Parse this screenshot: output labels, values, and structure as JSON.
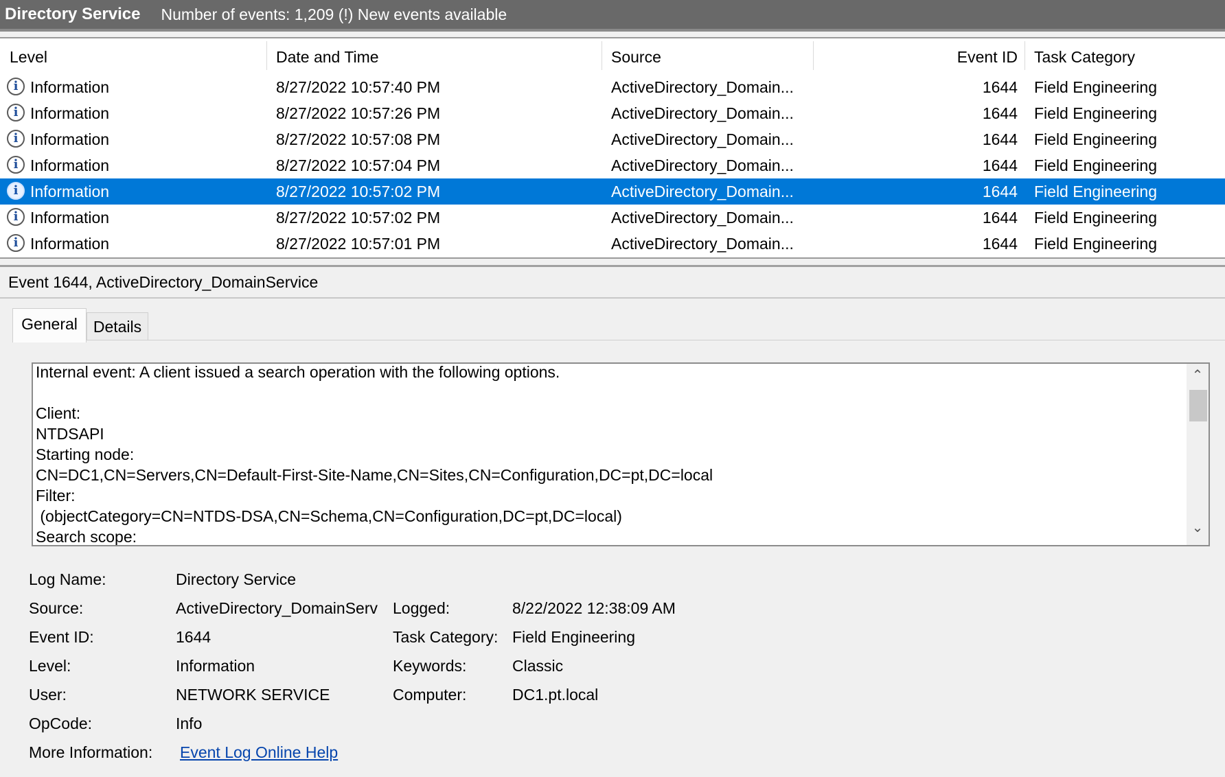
{
  "titlebar": {
    "app_name": "Directory Service",
    "event_count": "Number of events: 1,209 (!) New events available"
  },
  "grid": {
    "columns": [
      "Level",
      "Date and Time",
      "Source",
      "Event ID",
      "Task Category"
    ],
    "rows": [
      {
        "level": "Information",
        "datetime": "8/27/2022 10:57:40 PM",
        "source": "ActiveDirectory_Domain...",
        "event_id": "1644",
        "task": "Field Engineering",
        "selected": false
      },
      {
        "level": "Information",
        "datetime": "8/27/2022 10:57:26 PM",
        "source": "ActiveDirectory_Domain...",
        "event_id": "1644",
        "task": "Field Engineering",
        "selected": false
      },
      {
        "level": "Information",
        "datetime": "8/27/2022 10:57:08 PM",
        "source": "ActiveDirectory_Domain...",
        "event_id": "1644",
        "task": "Field Engineering",
        "selected": false
      },
      {
        "level": "Information",
        "datetime": "8/27/2022 10:57:04 PM",
        "source": "ActiveDirectory_Domain...",
        "event_id": "1644",
        "task": "Field Engineering",
        "selected": false
      },
      {
        "level": "Information",
        "datetime": "8/27/2022 10:57:02 PM",
        "source": "ActiveDirectory_Domain...",
        "event_id": "1644",
        "task": "Field Engineering",
        "selected": true
      },
      {
        "level": "Information",
        "datetime": "8/27/2022 10:57:02 PM",
        "source": "ActiveDirectory_Domain...",
        "event_id": "1644",
        "task": "Field Engineering",
        "selected": false
      },
      {
        "level": "Information",
        "datetime": "8/27/2022 10:57:01 PM",
        "source": "ActiveDirectory_Domain...",
        "event_id": "1644",
        "task": "Field Engineering",
        "selected": false
      }
    ],
    "level_icon": "information-icon",
    "selected_color": "#0078d7"
  },
  "event": {
    "header": "Event 1644, ActiveDirectory_DomainService",
    "tabs": [
      "General",
      "Details"
    ],
    "description_lines": [
      "Internal event: A client issued a search operation with the following options.",
      "",
      "Client:",
      "NTDSAPI",
      "Starting node:",
      "CN=DC1,CN=Servers,CN=Default-First-Site-Name,CN=Sites,CN=Configuration,DC=pt,DC=local",
      "Filter:",
      " (objectCategory=CN=NTDS-DSA,CN=Schema,CN=Configuration,DC=pt,DC=local)",
      "Search scope:"
    ],
    "scroll_up_glyph": "⌃",
    "scroll_down_glyph": "⌄",
    "properties": {
      "log_name_label": "Log Name:",
      "log_name": "Directory Service",
      "source_label": "Source:",
      "source": "ActiveDirectory_DomainServ",
      "logged_label": "Logged:",
      "logged": "8/22/2022 12:38:09 AM",
      "event_id_label": "Event ID:",
      "event_id": "1644",
      "task_category_label": "Task Category:",
      "task_category": "Field Engineering",
      "level_label": "Level:",
      "level": "Information",
      "keywords_label": "Keywords:",
      "keywords": "Classic",
      "user_label": "User:",
      "user": "NETWORK SERVICE",
      "computer_label": "Computer:",
      "computer": "DC1.pt.local",
      "opcode_label": "OpCode:",
      "opcode": "Info",
      "more_info_label": "More Information:",
      "more_info_link": "Event Log Online Help"
    }
  }
}
